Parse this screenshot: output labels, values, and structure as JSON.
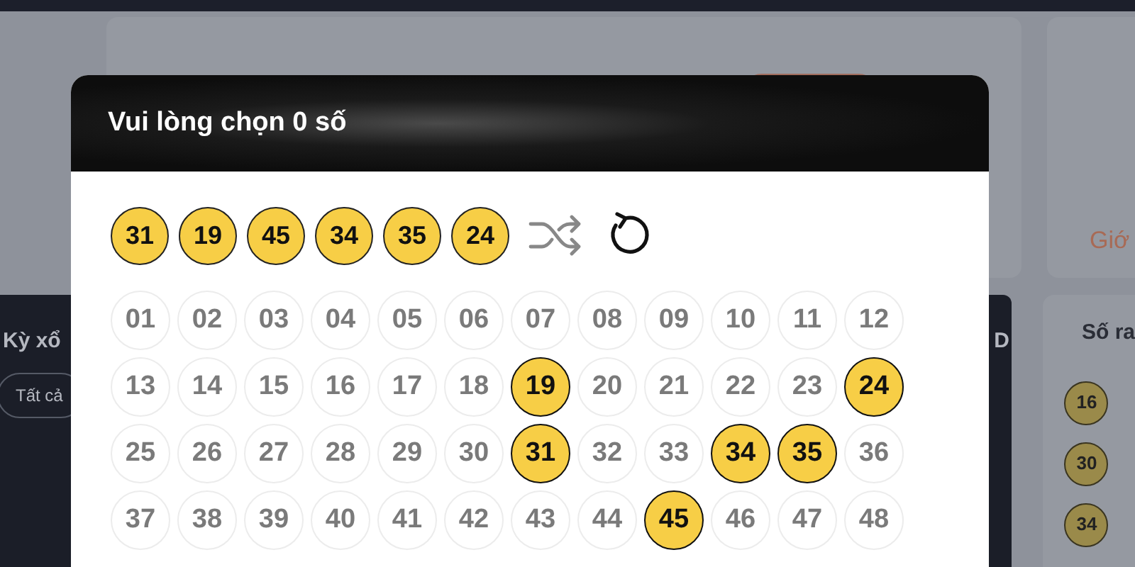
{
  "background": {
    "right_card_text": "Giớ",
    "filter_label": "Kỳ xổ",
    "filter_chip": "Tất cả",
    "column_text": "D",
    "side_title": "Số ra",
    "side_balls": [
      "16",
      "30",
      "34"
    ]
  },
  "modal": {
    "title": "Vui lòng chọn 0 số",
    "picked": [
      "31",
      "19",
      "45",
      "34",
      "35",
      "24"
    ],
    "numbers": [
      {
        "label": "01",
        "selected": false
      },
      {
        "label": "02",
        "selected": false
      },
      {
        "label": "03",
        "selected": false
      },
      {
        "label": "04",
        "selected": false
      },
      {
        "label": "05",
        "selected": false
      },
      {
        "label": "06",
        "selected": false
      },
      {
        "label": "07",
        "selected": false
      },
      {
        "label": "08",
        "selected": false
      },
      {
        "label": "09",
        "selected": false
      },
      {
        "label": "10",
        "selected": false
      },
      {
        "label": "11",
        "selected": false
      },
      {
        "label": "12",
        "selected": false
      },
      {
        "label": "13",
        "selected": false
      },
      {
        "label": "14",
        "selected": false
      },
      {
        "label": "15",
        "selected": false
      },
      {
        "label": "16",
        "selected": false
      },
      {
        "label": "17",
        "selected": false
      },
      {
        "label": "18",
        "selected": false
      },
      {
        "label": "19",
        "selected": true
      },
      {
        "label": "20",
        "selected": false
      },
      {
        "label": "21",
        "selected": false
      },
      {
        "label": "22",
        "selected": false
      },
      {
        "label": "23",
        "selected": false
      },
      {
        "label": "24",
        "selected": true
      },
      {
        "label": "25",
        "selected": false
      },
      {
        "label": "26",
        "selected": false
      },
      {
        "label": "27",
        "selected": false
      },
      {
        "label": "28",
        "selected": false
      },
      {
        "label": "29",
        "selected": false
      },
      {
        "label": "30",
        "selected": false
      },
      {
        "label": "31",
        "selected": true
      },
      {
        "label": "32",
        "selected": false
      },
      {
        "label": "33",
        "selected": false
      },
      {
        "label": "34",
        "selected": true
      },
      {
        "label": "35",
        "selected": true
      },
      {
        "label": "36",
        "selected": false
      },
      {
        "label": "37",
        "selected": false
      },
      {
        "label": "38",
        "selected": false
      },
      {
        "label": "39",
        "selected": false
      },
      {
        "label": "40",
        "selected": false
      },
      {
        "label": "41",
        "selected": false
      },
      {
        "label": "42",
        "selected": false
      },
      {
        "label": "43",
        "selected": false
      },
      {
        "label": "44",
        "selected": false
      },
      {
        "label": "45",
        "selected": true
      },
      {
        "label": "46",
        "selected": false
      },
      {
        "label": "47",
        "selected": false
      },
      {
        "label": "48",
        "selected": false
      }
    ]
  }
}
